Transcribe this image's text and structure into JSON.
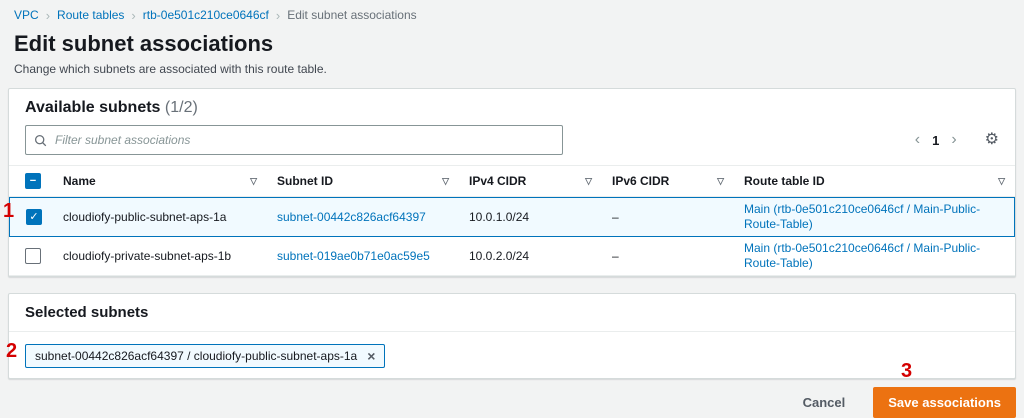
{
  "breadcrumb": {
    "items": [
      "VPC",
      "Route tables",
      "rtb-0e501c210ce0646cf",
      "Edit subnet associations"
    ]
  },
  "page": {
    "title": "Edit subnet associations",
    "description": "Change which subnets are associated with this route table."
  },
  "available_subnets": {
    "title": "Available subnets",
    "count": "(1/2)",
    "filter_placeholder": "Filter subnet associations",
    "pagination_page": "1",
    "columns": [
      "Name",
      "Subnet ID",
      "IPv4 CIDR",
      "IPv6 CIDR",
      "Route table ID"
    ],
    "rows": [
      {
        "selected": true,
        "name": "cloudiofy-public-subnet-aps-1a",
        "subnet_id": "subnet-00442c826acf64397",
        "ipv4_cidr": "10.0.1.0/24",
        "ipv6_cidr": "–",
        "route_table": "Main (rtb-0e501c210ce0646cf / Main-Public-Route-Table)"
      },
      {
        "selected": false,
        "name": "cloudiofy-private-subnet-aps-1b",
        "subnet_id": "subnet-019ae0b71e0ac59e5",
        "ipv4_cidr": "10.0.2.0/24",
        "ipv6_cidr": "–",
        "route_table": "Main (rtb-0e501c210ce0646cf / Main-Public-Route-Table)"
      }
    ]
  },
  "selected_subnets": {
    "title": "Selected subnets",
    "chips": [
      {
        "label": "subnet-00442c826acf64397 / cloudiofy-public-subnet-aps-1a"
      }
    ]
  },
  "footer": {
    "cancel_label": "Cancel",
    "save_label": "Save associations"
  },
  "annotations": [
    "1",
    "2",
    "3"
  ],
  "icons": {
    "breadcrumb_separator": "›",
    "sort": "▽",
    "page_prev": "‹",
    "page_next": "›",
    "settings_gear": "⚙",
    "chip_close": "×",
    "checkbox_check": "✓",
    "checkbox_indeterminate": "−"
  },
  "colors": {
    "link_blue": "#0073bb",
    "primary_orange": "#ec7211",
    "annotation_red": "#d40000",
    "selected_row_bg": "#f1faff",
    "selected_row_border": "#0073bb"
  }
}
